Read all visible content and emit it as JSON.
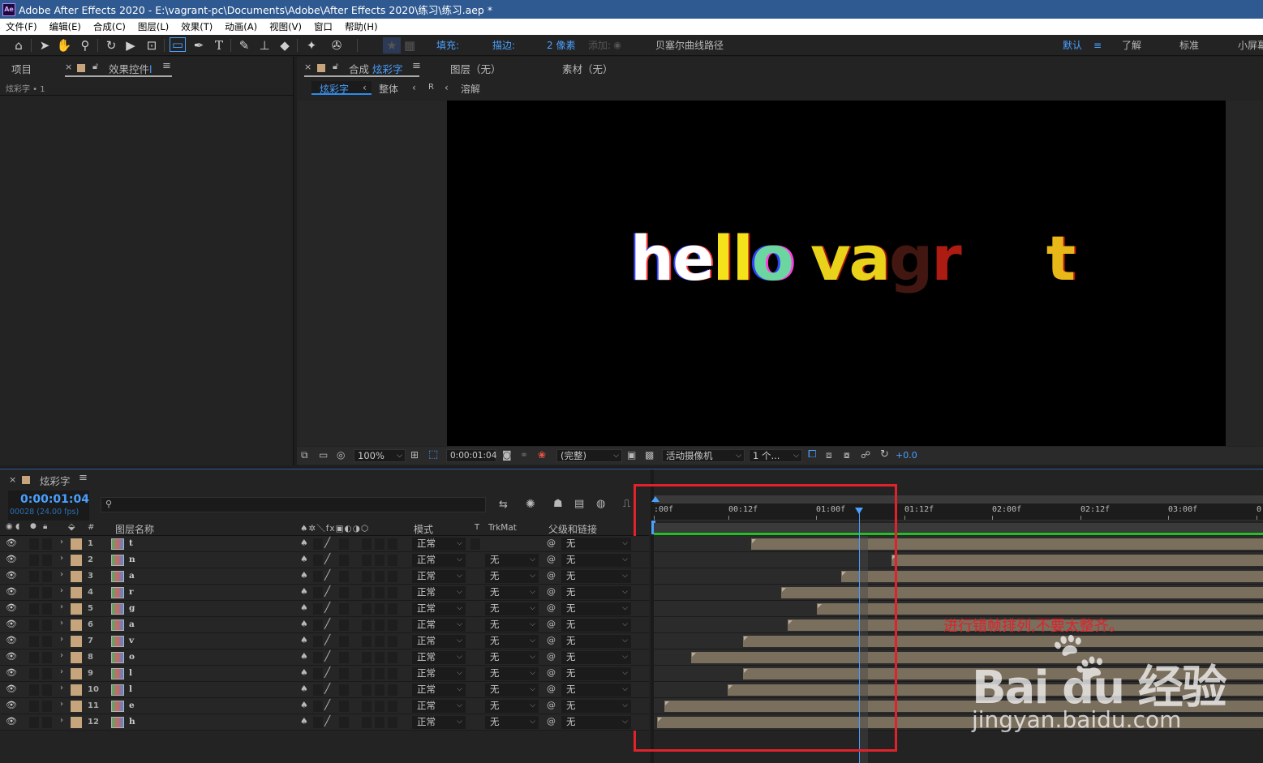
{
  "window": {
    "title": "Adobe After Effects 2020 - E:\\vagrant-pc\\Documents\\Adobe\\After Effects 2020\\练习\\练习.aep *",
    "app_badge": "Ae"
  },
  "menu": [
    "文件(F)",
    "编辑(E)",
    "合成(C)",
    "图层(L)",
    "效果(T)",
    "动画(A)",
    "视图(V)",
    "窗口",
    "帮助(H)"
  ],
  "toolbar": {
    "fill_label": "填充:",
    "stroke_label": "描边:",
    "stroke_width": "2 像素",
    "add_label": "添加:",
    "bezier_label": "贝塞尔曲线路径",
    "workspaces": [
      "默认",
      "了解",
      "标准",
      "小屏幕"
    ],
    "fill_color": "#5a33e6",
    "stroke_color": "#6b1616"
  },
  "project_panel": {
    "tab_project": "项目",
    "tab_effects": "效果控件",
    "effects_suffix": "l",
    "subheader": "炫彩字 • 1"
  },
  "comp_panel": {
    "tab_prefix": "合成",
    "comp_name": "炫彩字",
    "layer_tab": "图层（无）",
    "footage_tab": "素材（无）",
    "breadcrumbs": [
      "炫彩字",
      "整体",
      "R",
      "溶解"
    ]
  },
  "viewer": {
    "preview_text_parts": [
      "he",
      "ll",
      "o",
      "va",
      "g",
      "r",
      "t"
    ]
  },
  "viewer_bar": {
    "zoom": "100%",
    "timecode": "0:00:01:04",
    "quality": "(完整)",
    "camera": "活动摄像机",
    "views": "1 个...",
    "exposure": "+0.0"
  },
  "timeline": {
    "comp_tab": "炫彩字",
    "timecode": "0:00:01:04",
    "frames_fps": "00028 (24.00 fps)",
    "search_placeholder": "",
    "col_num": "#",
    "col_name": "图层名称",
    "col_mode": "模式",
    "col_t": "T",
    "col_trkmat": "TrkMat",
    "col_parent": "父级和链接",
    "ruler_ticks": [
      ":00f",
      "00:12f",
      "01:00f",
      "01:12f",
      "02:00f",
      "02:12f",
      "03:00f",
      "0"
    ],
    "layers": [
      {
        "num": "1",
        "name": "t",
        "mode": "正常",
        "trkmat": "",
        "parent": "无",
        "start": 0.553
      },
      {
        "num": "2",
        "name": "n",
        "mode": "正常",
        "trkmat": "无",
        "parent": "无",
        "start": 1.351
      },
      {
        "num": "3",
        "name": "a",
        "mode": "正常",
        "trkmat": "无",
        "parent": "无",
        "start": 1.064
      },
      {
        "num": "4",
        "name": "r",
        "mode": "正常",
        "trkmat": "无",
        "parent": "无",
        "start": 0.723
      },
      {
        "num": "5",
        "name": "g",
        "mode": "正常",
        "trkmat": "无",
        "parent": "无",
        "start": 0.926
      },
      {
        "num": "6",
        "name": "a",
        "mode": "正常",
        "trkmat": "无",
        "parent": "无",
        "start": 0.761
      },
      {
        "num": "7",
        "name": "v",
        "mode": "正常",
        "trkmat": "无",
        "parent": "无",
        "start": 0.505
      },
      {
        "num": "8",
        "name": "o",
        "mode": "正常",
        "trkmat": "无",
        "parent": "无",
        "start": 0.213
      },
      {
        "num": "9",
        "name": "l",
        "mode": "正常",
        "trkmat": "无",
        "parent": "无",
        "start": 0.505
      },
      {
        "num": "10",
        "name": "l",
        "mode": "正常",
        "trkmat": "无",
        "parent": "无",
        "start": 0.42
      },
      {
        "num": "11",
        "name": "e",
        "mode": "正常",
        "trkmat": "无",
        "parent": "无",
        "start": 0.058
      },
      {
        "num": "12",
        "name": "h",
        "mode": "正常",
        "trkmat": "无",
        "parent": "无",
        "start": 0.017
      }
    ],
    "playhead_time": 1.167
  },
  "annotation": {
    "note": "进行错帧排列,不要太整齐。"
  },
  "watermark": {
    "brand": "Bai du 经验",
    "url": "jingyan.baidu.com"
  },
  "colors": {
    "accent": "#2d8ceb",
    "highlight_box": "#e0222a",
    "label_tan": "#c7a57c",
    "layer_bar": "#7a6e5d"
  }
}
